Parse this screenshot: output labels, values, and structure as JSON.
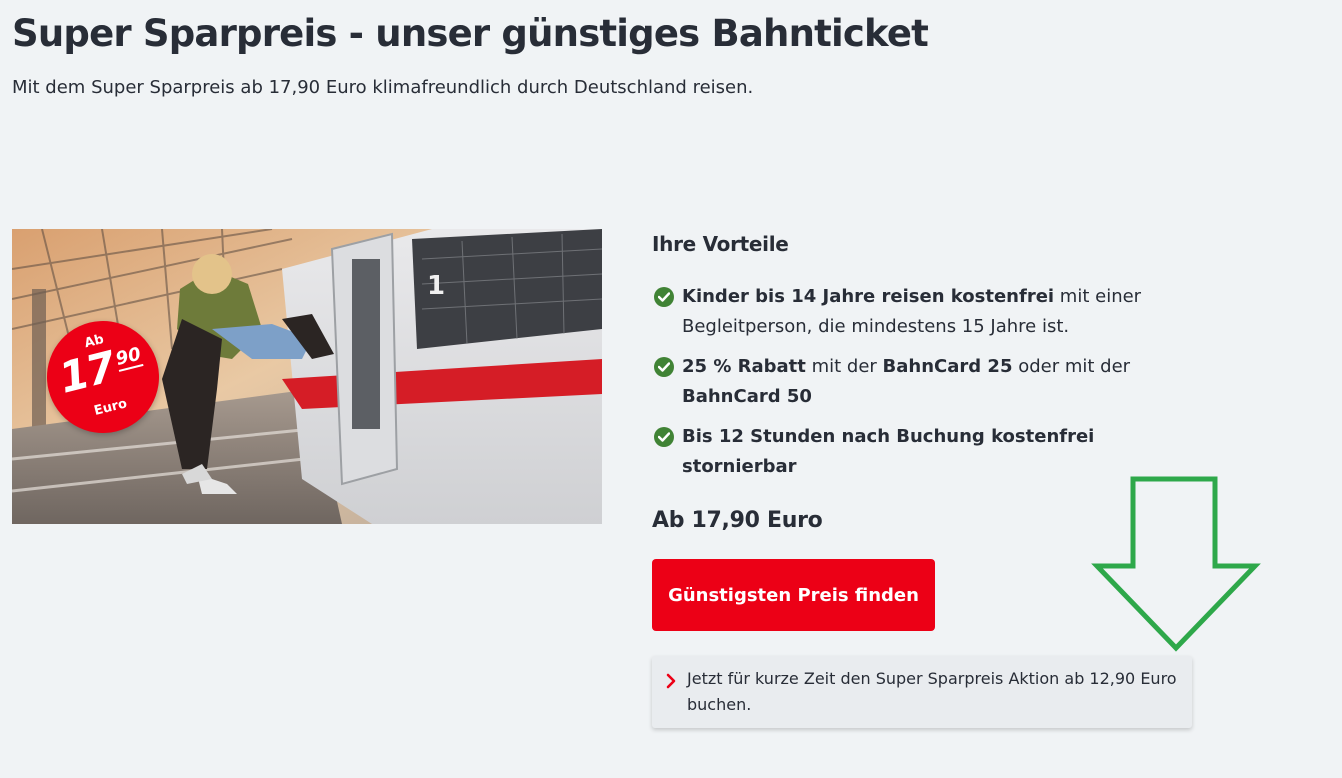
{
  "page": {
    "title": "Super Sparpreis - unser günstiges Bahnticket",
    "subtitle": "Mit dem Super Sparpreis ab 17,90 Euro klimafreundlich durch Deutschland reisen."
  },
  "hero": {
    "badge": {
      "ab": "Ab",
      "number": "17",
      "decimal": "90",
      "euro": "Euro"
    },
    "coach_class": "1"
  },
  "benefits": {
    "heading": "Ihre Vorteile",
    "items": [
      {
        "bold1": "Kinder bis 14 Jahre reisen kostenfrei",
        "text1": " mit einer Begleitperson, die mindestens 15 Jahre ist.",
        "bold2": "",
        "text2": "",
        "bold3": ""
      },
      {
        "bold1": "25 % Rabatt",
        "text1": " mit der ",
        "bold2": "BahnCard 25",
        "text2": " oder mit der ",
        "bold3": "BahnCard 50"
      },
      {
        "bold1": "Bis 12 Stunden nach Buchung kostenfrei stornierbar",
        "text1": "",
        "bold2": "",
        "text2": "",
        "bold3": ""
      }
    ]
  },
  "price": {
    "label": "Ab 17,90 Euro"
  },
  "cta": {
    "label": "Günstigsten Preis finden"
  },
  "promo": {
    "text": "Jetzt für kurze Zeit den Super Sparpreis Aktion ab 12,90 Euro buchen."
  },
  "colors": {
    "brand_red": "#ec0016",
    "check_green": "#408335",
    "annotation_green": "#2ea84a",
    "background": "#f0f3f5"
  },
  "icons": {
    "benefit": "check-circle-icon",
    "promo": "chevron-right-icon",
    "annotation": "arrow-down-icon"
  }
}
